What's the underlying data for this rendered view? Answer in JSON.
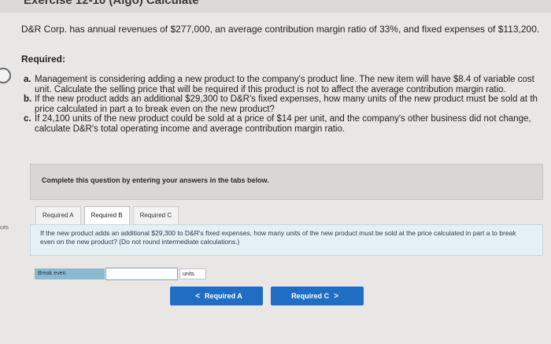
{
  "header": {
    "title": "Exercise 12-10 (Algo) Calculate"
  },
  "problem": {
    "statement": "D&R Corp. has annual revenues of $277,000, an average contribution margin ratio of 33%, and fixed expenses of $113,200."
  },
  "requirements": {
    "heading": "Required:",
    "items": [
      {
        "letter": "a.",
        "line1": "Management is considering adding a new product to the company's product line. The new item will have $8.4 of variable cost",
        "line2": "unit. Calculate the selling price that will be required if this product is not to affect the average contribution margin ratio."
      },
      {
        "letter": "b.",
        "line1": "If the new product adds an additional $29,300 to D&R's fixed expenses, how many units of the new product must be sold at th",
        "line2": "price calculated in part a to break even on the new product?"
      },
      {
        "letter": "c.",
        "line1": "If 24,100 units of the new product could be sold at a price of $14 per unit, and the company's other business did not change,",
        "line2": "calculate D&R's total operating income and average contribution margin ratio."
      }
    ]
  },
  "side": {
    "label": "ces"
  },
  "instruction": {
    "text": "Complete this question by entering your answers in the tabs below."
  },
  "tabs": [
    {
      "label": "Required A"
    },
    {
      "label": "Required B"
    },
    {
      "label": "Required C"
    }
  ],
  "question": {
    "text": "If the new product adds an additional $29,300 to D&R's fixed expenses, how many units of the new product must be sold at the price calculated in part a to break even on the new product? (Do not round intermediate calculations.)"
  },
  "answer": {
    "label": "Break even",
    "value": "",
    "unit": "units"
  },
  "navigation": {
    "prev_label": "Required A",
    "next_label": "Required C",
    "prev_chevron": "<",
    "next_chevron": ">"
  },
  "colors": {
    "accent": "#1f6ec4",
    "panel": "#e4f0f4",
    "answer_label_bg": "#8bbad0"
  }
}
